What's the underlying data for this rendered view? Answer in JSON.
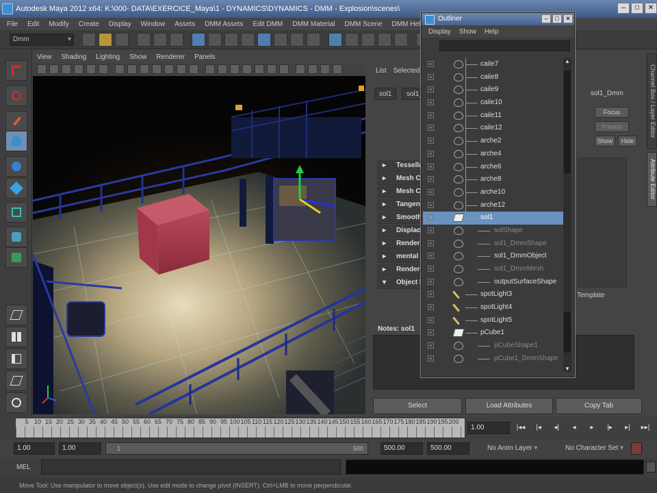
{
  "window": {
    "title": "Autodesk Maya 2012 x64: K:\\000- DATA\\EXERCICE_Maya\\1 - DYNAMICS\\DYNAMICS - DMM - Explosion\\scenes\\"
  },
  "menubar": {
    "items": [
      "File",
      "Edit",
      "Modify",
      "Create",
      "Display",
      "Window",
      "Assets",
      "DMM Assets",
      "Edit DMM",
      "DMM Material",
      "DMM Scene",
      "DMM Help"
    ]
  },
  "statusline": {
    "mode": "Dmm"
  },
  "viewport": {
    "menus": [
      "View",
      "Shading",
      "Lighting",
      "Show",
      "Renderer",
      "Panels"
    ]
  },
  "attribute_editor": {
    "menus": [
      "List",
      "Selected"
    ],
    "tabs": [
      "sol1",
      "sol1_DmmShape"
    ],
    "node_tab": "sol1_Dmm",
    "focus_button": "Focus",
    "presets_button": "Presets",
    "show_button": "Show",
    "hide_button": "Hide",
    "sections": [
      "Tessellation",
      "Mesh Component Display",
      "Mesh Controls",
      "Tangent Space",
      "Smooth Mesh",
      "Displacement Map",
      "Render Stats",
      "mental ray",
      "RenderMan",
      "Object Display"
    ],
    "template_label": "Template",
    "notes_label": "Notes: sol1",
    "buttons": {
      "select": "Select",
      "load": "Load Attributes",
      "copy": "Copy Tab"
    },
    "side_tabs": [
      "Channel Box / Layer Editor",
      "Attribute Editor"
    ]
  },
  "outliner": {
    "title": "Outliner",
    "menus": [
      "Display",
      "Show",
      "Help"
    ],
    "rows": [
      {
        "label": "caile7",
        "icon": "eye-icon",
        "kind": "child"
      },
      {
        "label": "caile8",
        "icon": "eye-icon",
        "kind": "child"
      },
      {
        "label": "caile9",
        "icon": "eye-icon",
        "kind": "child"
      },
      {
        "label": "caile10",
        "icon": "eye-icon",
        "kind": "child"
      },
      {
        "label": "caile11",
        "icon": "eye-icon",
        "kind": "child"
      },
      {
        "label": "caile12",
        "icon": "eye-icon",
        "kind": "child"
      },
      {
        "label": "arche2",
        "icon": "eye-icon",
        "kind": "child"
      },
      {
        "label": "arche4",
        "icon": "eye-icon",
        "kind": "child"
      },
      {
        "label": "arche6",
        "icon": "eye-icon",
        "kind": "child"
      },
      {
        "label": "arche8",
        "icon": "eye-icon",
        "kind": "child"
      },
      {
        "label": "arche10",
        "icon": "eye-icon",
        "kind": "child"
      },
      {
        "label": "arche12",
        "icon": "eye-icon",
        "kind": "child"
      },
      {
        "label": "sol1",
        "icon": "mesh-icon",
        "kind": "selected"
      },
      {
        "label": "solShape",
        "icon": "eye-icon",
        "kind": "grandchild-dim"
      },
      {
        "label": "sol1_DmmShape",
        "icon": "eye-icon",
        "kind": "grandchild-dim"
      },
      {
        "label": "sol1_DmmObject",
        "icon": "eye-icon",
        "kind": "grandchild"
      },
      {
        "label": "sol1_DmmMesh",
        "icon": "eye-icon",
        "kind": "grandchild-dim"
      },
      {
        "label": "outputSurfaceShape",
        "icon": "eye-icon",
        "kind": "grandchild"
      },
      {
        "label": "spotLight3",
        "icon": "light-icon",
        "kind": "top"
      },
      {
        "label": "spotLight4",
        "icon": "light-icon",
        "kind": "top"
      },
      {
        "label": "spotLight5",
        "icon": "light-icon",
        "kind": "top"
      },
      {
        "label": "pCube1",
        "icon": "mesh-icon",
        "kind": "top"
      },
      {
        "label": "pCubeShape1",
        "icon": "eye-icon",
        "kind": "grandchild-dim"
      },
      {
        "label": "pCube1_DmmShape",
        "icon": "eye-icon",
        "kind": "grandchild-dim"
      }
    ]
  },
  "timeslider": {
    "ticks": [
      "5",
      "10",
      "15",
      "20",
      "25",
      "30",
      "35",
      "40",
      "45",
      "50",
      "55",
      "60",
      "65",
      "70",
      "75",
      "80",
      "85",
      "90",
      "95",
      "100",
      "105",
      "110",
      "115",
      "120",
      "125",
      "130",
      "135",
      "140",
      "145",
      "150",
      "155",
      "160",
      "165",
      "170",
      "175",
      "180",
      "185",
      "190",
      "195",
      "200"
    ],
    "current_frame": "1.00",
    "playback_controls": [
      "|◂◂",
      "|◂",
      "◂|",
      "◂",
      "▸",
      "|▸",
      "▸|",
      "▸▸|"
    ]
  },
  "rangebar": {
    "start": "1.00",
    "range_start": "1.00",
    "range_handle_left": "1",
    "range_handle_right": "500",
    "range_end": "500.00",
    "end": "500.00",
    "anim_layer": "No Anim Layer",
    "character_set": "No Character Set"
  },
  "commandline": {
    "language": "MEL"
  },
  "helpline": {
    "text": "Move Tool: Use manipulator to move object(s). Use edit mode to change pivot (INSERT). Ctrl+LMB to move perpendicular."
  }
}
